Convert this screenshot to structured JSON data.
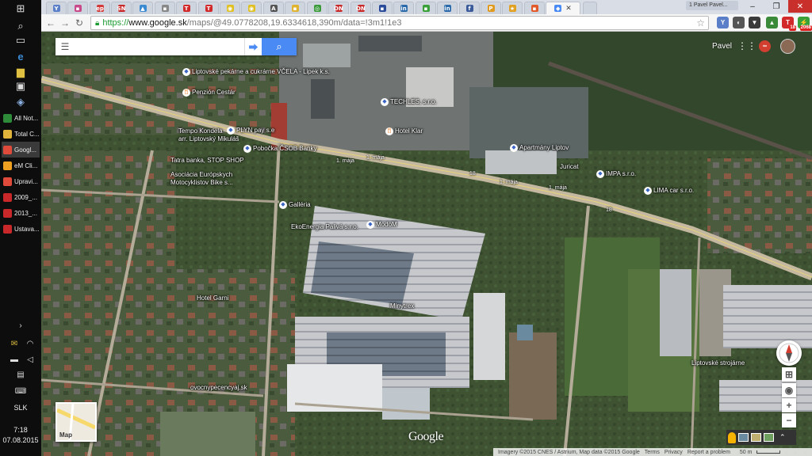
{
  "taskbar": {
    "icons": [
      "windows-logo-icon",
      "search-icon",
      "task-view-icon",
      "edge-icon",
      "file-explorer-icon",
      "store-icon",
      "app-icon"
    ],
    "apps": [
      {
        "label": "All Not...",
        "color": "#2e8b3a"
      },
      {
        "label": "Total C...",
        "color": "#e0b43a"
      },
      {
        "label": "Googl...",
        "color": "#e04a3a"
      },
      {
        "label": "eM Cli...",
        "color": "#f0a020"
      },
      {
        "label": "Upravi...",
        "color": "#e04a3a"
      },
      {
        "label": "2009_...",
        "color": "#c8282a"
      },
      {
        "label": "2013_...",
        "color": "#c8282a"
      },
      {
        "label": "Ustava...",
        "color": "#c8282a"
      }
    ],
    "language": "SLK",
    "time": "7:18",
    "date": "07.08.2015"
  },
  "browser": {
    "user_chip": "1 Pavel Pavel...",
    "tabs": [
      {
        "fav": "Y",
        "color": "#5a7fc8"
      },
      {
        "fav": "▪",
        "color": "#c84a8a"
      },
      {
        "fav": "ep",
        "color": "#d23a3a"
      },
      {
        "fav": "SN",
        "color": "#c82a2a"
      },
      {
        "fav": "▲",
        "color": "#3a8ad2"
      },
      {
        "fav": "▪",
        "color": "#888888"
      },
      {
        "fav": "T",
        "color": "#d22a2a"
      },
      {
        "fav": "T",
        "color": "#d22a2a"
      },
      {
        "fav": "◉",
        "color": "#e0c020"
      },
      {
        "fav": "◉",
        "color": "#e0c020"
      },
      {
        "fav": "A",
        "color": "#555555"
      },
      {
        "fav": "▪",
        "color": "#e0b430"
      },
      {
        "fav": "◎",
        "color": "#3a9a3a"
      },
      {
        "fav": "DN",
        "color": "#c82a2a"
      },
      {
        "fav": "DN",
        "color": "#c82a2a"
      },
      {
        "fav": "▪",
        "color": "#2a4a9a"
      },
      {
        "fav": "in",
        "color": "#2a6aaa"
      },
      {
        "fav": "▪",
        "color": "#3aa03a"
      },
      {
        "fav": "in",
        "color": "#2a6aaa"
      },
      {
        "fav": "f",
        "color": "#3a5a9a"
      },
      {
        "fav": "P",
        "color": "#e09a20"
      },
      {
        "fav": "★",
        "color": "#e0a020"
      },
      {
        "fav": "▪",
        "color": "#e05a2a"
      },
      {
        "fav": "◆",
        "color": "#4a8af4"
      }
    ],
    "url": {
      "scheme": "https://",
      "host": "www.google.sk",
      "path": "/maps/@49.0778208,19.6334618,390m/data=!3m1!1e3"
    },
    "extensions": [
      {
        "glyph": "Y",
        "color": "#5a7fc8",
        "badge": ""
      },
      {
        "glyph": "◐",
        "color": "#555555",
        "badge": ""
      },
      {
        "glyph": "▼",
        "color": "#3a3a3a",
        "badge": ""
      },
      {
        "glyph": "▲",
        "color": "#3a8a3a",
        "badge": ""
      },
      {
        "glyph": "T",
        "color": "#d22a2a",
        "badge": "18"
      },
      {
        "glyph": "⚡",
        "color": "#3aa03a",
        "badge": "2068"
      },
      {
        "glyph": "≡",
        "color": "#555555",
        "badge": ""
      }
    ]
  },
  "map": {
    "search": {
      "placeholder": "",
      "value": ""
    },
    "account_name": "Pavel",
    "minimap_label": "Map",
    "google_logo": "Google",
    "labels": [
      {
        "text": "Liptovské pekárne a cukrárne VČELA - Lipek k.s.",
        "kind": "poi"
      },
      {
        "text": "Penzión Cestár",
        "kind": "food"
      },
      {
        "text": "TECHLES, s.r.o.",
        "kind": "poi"
      },
      {
        "text": "Tempo Kondela",
        "kind": "text"
      },
      {
        "text": "arr. Liptovský Mikuláš",
        "kind": "text"
      },
      {
        "text": "PLYN pay s.e",
        "kind": "poi"
      },
      {
        "text": "Hotel Klar",
        "kind": "food"
      },
      {
        "text": "Pobočka ČSOB Banky",
        "kind": "poi"
      },
      {
        "text": "Tatra banka, STOP SHOP",
        "kind": "text"
      },
      {
        "text": "Asociácia Európskych",
        "kind": "text"
      },
      {
        "text": "Motocyklistov Bike s...",
        "kind": "text"
      },
      {
        "text": "Apartmány Liptov",
        "kind": "poi"
      },
      {
        "text": "Juricat",
        "kind": "text"
      },
      {
        "text": "IMPA s.r.o.",
        "kind": "poi"
      },
      {
        "text": "LIMA car s.r.o.",
        "kind": "poi"
      },
      {
        "text": "Galléria",
        "kind": "poi"
      },
      {
        "text": "EkoEnergia Palivá s.r.o.",
        "kind": "text"
      },
      {
        "text": "ModoM",
        "kind": "poi"
      },
      {
        "text": "Hotel Garni",
        "kind": "text"
      },
      {
        "text": "Minytrex",
        "kind": "text"
      },
      {
        "text": "ovocnypecencyaj.sk",
        "kind": "text"
      },
      {
        "text": "Liptovské strojárne",
        "kind": "text"
      }
    ],
    "roads": [
      "1. mája",
      "1. mája",
      "1. mája",
      "1. mája",
      "18",
      "18"
    ],
    "footer": {
      "imagery": "Imagery ©2015 CNES / Astrium, Map data ©2015 Google",
      "terms": "Terms",
      "privacy": "Privacy",
      "report": "Report a problem",
      "scale": "50 m"
    }
  }
}
